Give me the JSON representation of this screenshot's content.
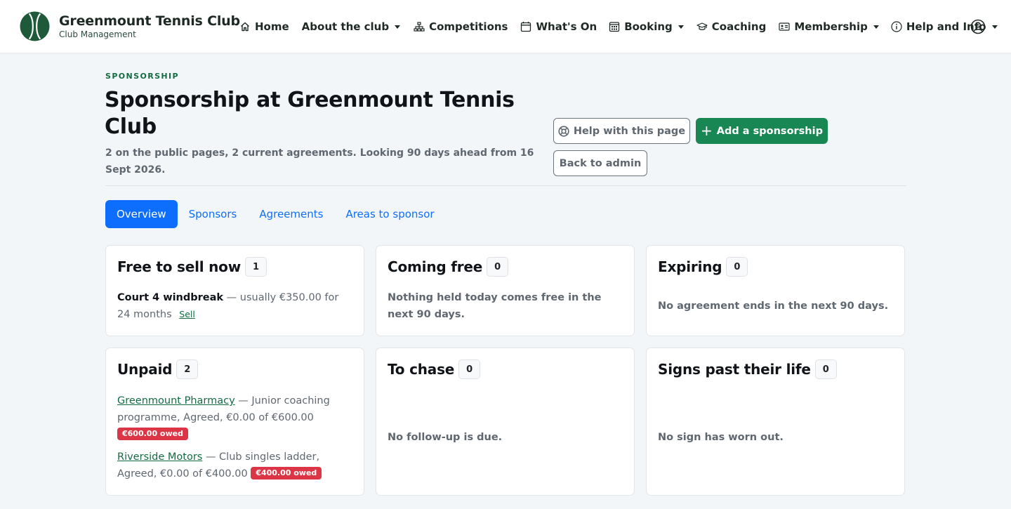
{
  "brand": {
    "title": "Greenmount Tennis Club",
    "subtitle": "Club Management",
    "logo_icon": "tennis-ball-icon",
    "logo_color": "#1e5a3a"
  },
  "nav": {
    "items": [
      {
        "label": "Home",
        "icon": "home-icon",
        "dropdown": false
      },
      {
        "label": "About the club",
        "icon": "",
        "dropdown": true
      },
      {
        "label": "Competitions",
        "icon": "sitemap-icon",
        "dropdown": false
      },
      {
        "label": "What's On",
        "icon": "calendar-icon",
        "dropdown": false
      },
      {
        "label": "Booking",
        "icon": "calendar-grid-icon",
        "dropdown": true
      },
      {
        "label": "Coaching",
        "icon": "mortarboard-icon",
        "dropdown": false
      },
      {
        "label": "Membership",
        "icon": "id-card-icon",
        "dropdown": true
      },
      {
        "label": "Help and Info",
        "icon": "info-circle-icon",
        "dropdown": true
      }
    ],
    "profile_icon": "user-circle-icon"
  },
  "header": {
    "eyebrow": "SPONSORSHIP",
    "title": "Sponsorship at Greenmount Tennis Club",
    "lead": "2 on the public pages, 2 current agreements. Looking 90 days ahead from 16 Sept 2026.",
    "help_label": "Help with this page",
    "add_label": "Add a sponsorship",
    "back_label": "Back to admin"
  },
  "tabs": [
    {
      "label": "Overview",
      "active": true
    },
    {
      "label": "Sponsors",
      "active": false
    },
    {
      "label": "Agreements",
      "active": false
    },
    {
      "label": "Areas to sponsor",
      "active": false
    }
  ],
  "cards": {
    "free": {
      "title": "Free to sell now",
      "count": "1",
      "item_name": "Court 4 windbreak",
      "item_detail": " — usually €350.00 for 24 months",
      "sell_label": "Sell"
    },
    "coming": {
      "title": "Coming free",
      "count": "0",
      "message": "Nothing held today comes free in the next 90 days."
    },
    "expiring": {
      "title": "Expiring",
      "count": "0",
      "message": "No agreement ends in the next 90 days."
    },
    "unpaid": {
      "title": "Unpaid",
      "count": "2",
      "items": [
        {
          "sponsor": "Greenmount Pharmacy",
          "detail": " — Junior coaching programme, Agreed, €0.00 of €600.00",
          "owed": "€600.00 owed"
        },
        {
          "sponsor": "Riverside Motors",
          "detail": " — Club singles ladder, Agreed, €0.00 of €400.00",
          "owed": "€400.00 owed"
        }
      ]
    },
    "chase": {
      "title": "To chase",
      "count": "0",
      "message": "No follow-up is due."
    },
    "signs": {
      "title": "Signs past their life",
      "count": "0",
      "message": "No sign has worn out."
    }
  },
  "colors": {
    "primary": "#0d6efd",
    "success": "#198754",
    "danger": "#dc3545",
    "brand_green": "#146c43"
  }
}
